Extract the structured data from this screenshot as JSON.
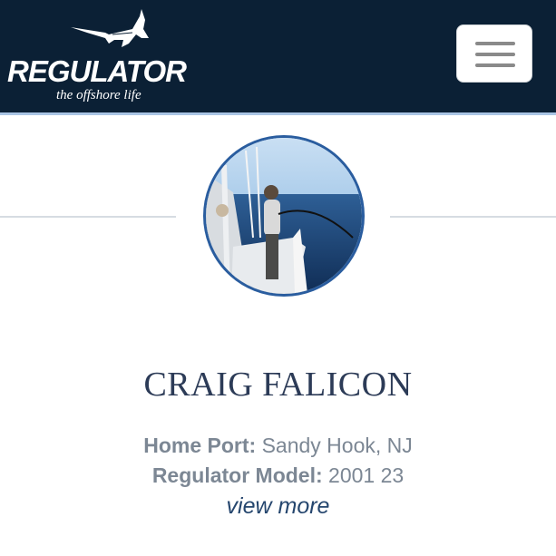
{
  "header": {
    "logo_text": "REGULATOR",
    "tagline": "the offshore life",
    "menu_icon": "hamburger-menu-icon",
    "background_color": "#0b2035"
  },
  "profile": {
    "photo_description_icon": "angler-profile-photo",
    "name": "CRAIG FALICON",
    "home_port_label": "Home Port:",
    "home_port_value": "Sandy Hook, NJ",
    "model_label": "Regulator Model:",
    "model_value": "2001 23",
    "view_more_label": "view more"
  },
  "colors": {
    "accent_blue": "#2a5d9f",
    "name_color": "#2c3b57",
    "info_text": "#7c8794",
    "link_color": "#25466e"
  }
}
